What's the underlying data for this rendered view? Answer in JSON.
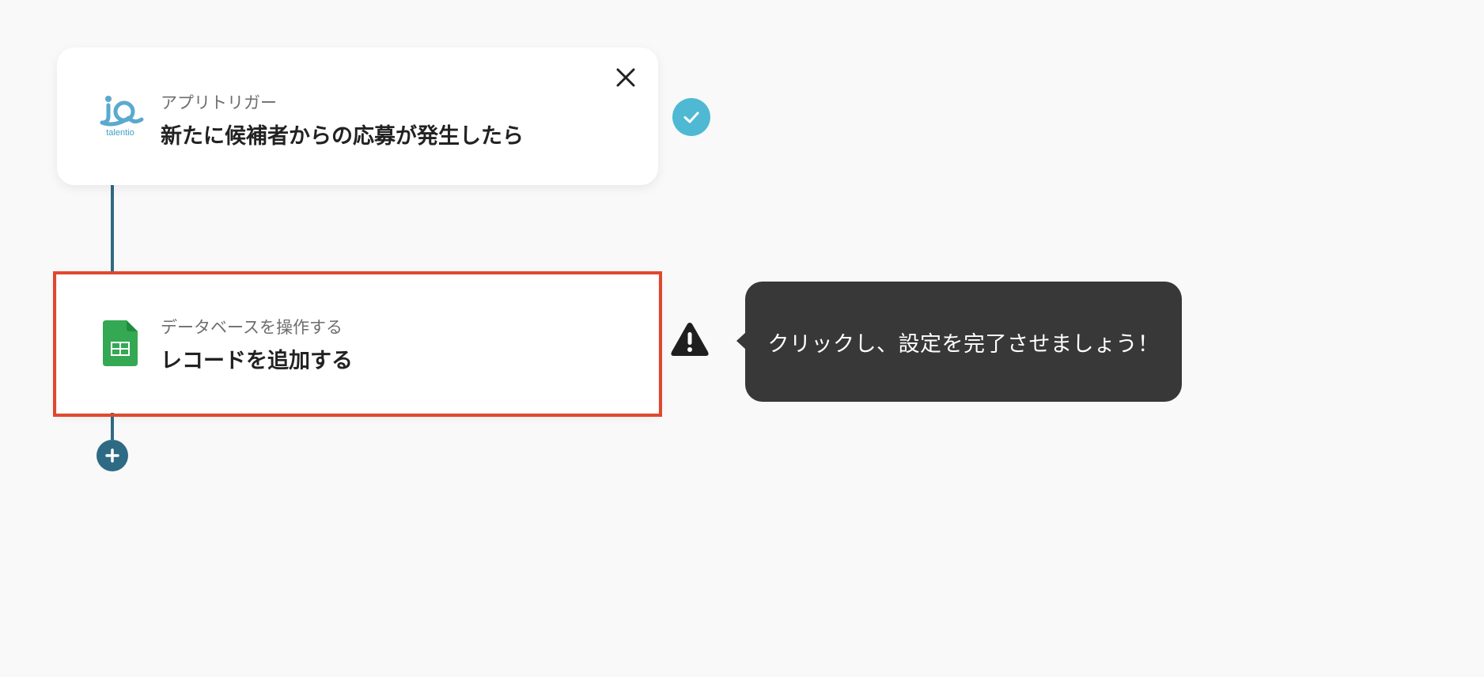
{
  "trigger": {
    "subtitle": "アプリトリガー",
    "title": "新たに候補者からの応募が発生したら",
    "app_icon": "talentio-logo-icon",
    "logo_text": "talentio",
    "status": "completed"
  },
  "action": {
    "subtitle": "データベースを操作する",
    "title": "レコードを追加する",
    "app_icon": "google-sheets-icon",
    "status": "warning"
  },
  "tooltip": {
    "text": "クリックし、設定を完了させましょう！"
  },
  "colors": {
    "background": "#f9f9f9",
    "connector": "#2f6a84",
    "check_badge": "#4fb9d4",
    "highlight_border": "#e0482e",
    "tooltip_bg": "#383838",
    "sheets_green": "#34a853"
  }
}
